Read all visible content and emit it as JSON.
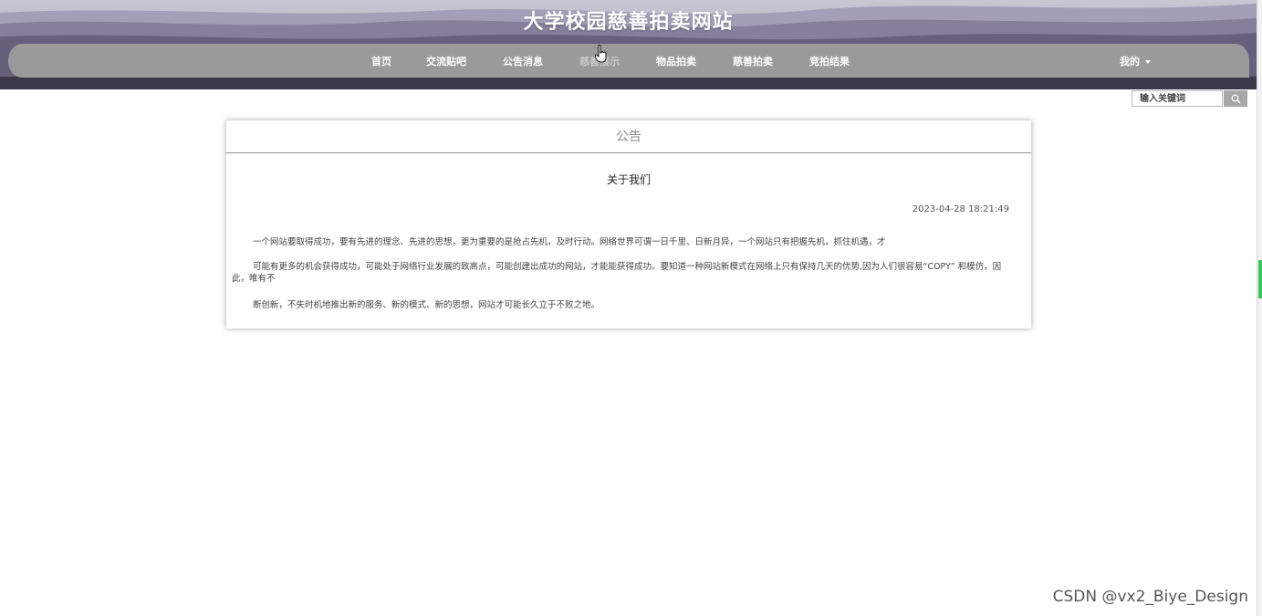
{
  "site": {
    "title": "大学校园慈善拍卖网站"
  },
  "nav": {
    "items": [
      {
        "label": "首页",
        "dim": false
      },
      {
        "label": "交流贴吧",
        "dim": false
      },
      {
        "label": "公告消息",
        "dim": false
      },
      {
        "label": "慈善展示",
        "dim": true
      },
      {
        "label": "物品拍卖",
        "dim": false
      },
      {
        "label": "慈善拍卖",
        "dim": false
      },
      {
        "label": "竞拍结果",
        "dim": false
      }
    ],
    "user_menu": "我的"
  },
  "search": {
    "placeholder": "输入关键词",
    "icon": "search-icon"
  },
  "notice": {
    "heading": "公告",
    "title": "关于我们",
    "date": "2023-04-28 18:21:49",
    "paragraphs": [
      "一个网站要取得成功，要有先进的理念、先进的思想，更为重要的是抢占先机，及时行动。网络世界可谓一日千里、日新月异，一个网站只有把握先机，抓住机遇，才",
      "可能有更多的机会获得成功，可能处于网络行业发展的致高点，可能创建出成功的网站，才能能获得成功。要知道一种网站新模式在网络上只有保持几天的优势,因为人们很容易“COPY” 和模仿，因此，唯有不",
      "断创新，不失时机地推出新的服务、新的模式、新的思想，网站才可能长久立于不败之地。"
    ]
  },
  "watermark": "CSDN @vx2_Biye_Design",
  "colors": {
    "navbar": "#9a9a9a",
    "header_dark": "#3d3a4c",
    "header_mid": "#6f6a86"
  }
}
